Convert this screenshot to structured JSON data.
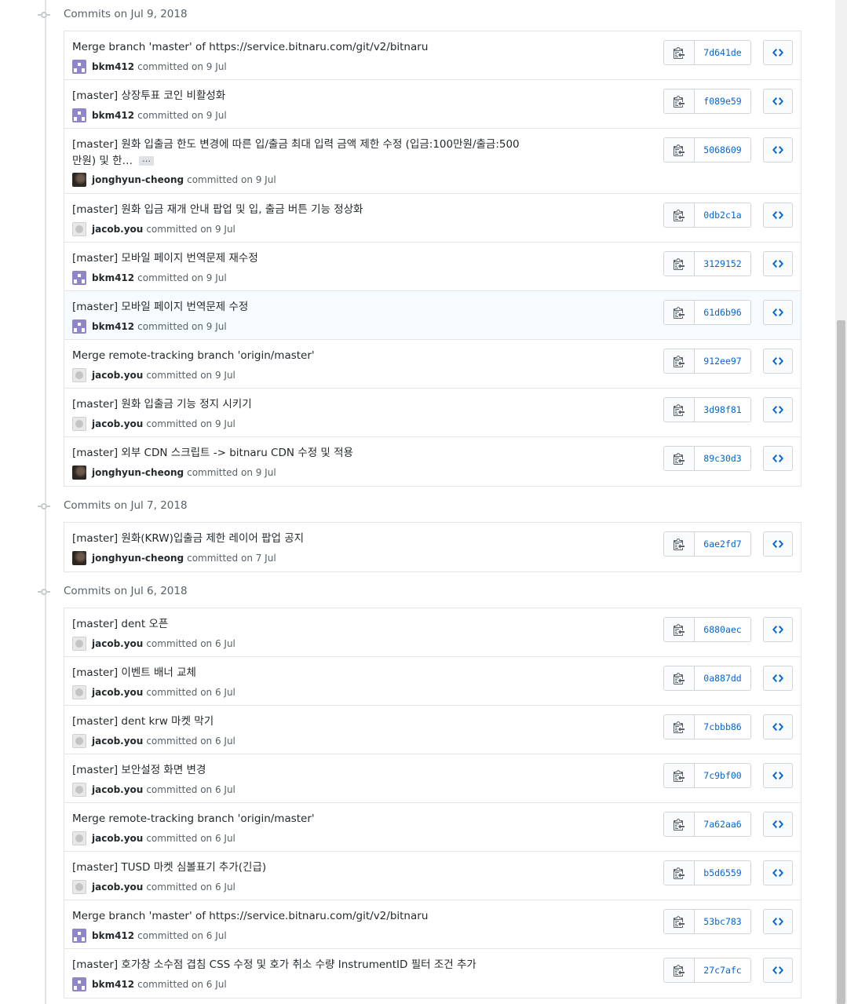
{
  "accent": "#0366d6",
  "groups": [
    {
      "title": "Commits on Jul 9, 2018",
      "commits": [
        {
          "message": "Merge branch 'master' of https://service.bitnaru.com/git/v2/bitnaru",
          "author": "bkm412",
          "committed": "committed on 9 Jul",
          "sha": "7d641de",
          "avatar": "identicon"
        },
        {
          "message": "[master] 상장투표 코인 비활성화",
          "author": "bkm412",
          "committed": "committed on 9 Jul",
          "sha": "f089e59",
          "avatar": "identicon"
        },
        {
          "message": "[master] 원화 입출금 한도 변경에 따른 입/출금 최대 입력 금액 제한 수정 (입금:100만원/출금:500만원) 및 한…",
          "ellipsis": "…",
          "author": "jonghyun-cheong",
          "committed": "committed on 9 Jul",
          "sha": "5068609",
          "avatar": "photo"
        },
        {
          "message": "[master] 원화 입금 재개 안내 팝업 및 입, 출금 버튼 기능 정상화",
          "author": "jacob.you",
          "committed": "committed on 9 Jul",
          "sha": "0db2c1a",
          "avatar": "default"
        },
        {
          "message": "[master] 모바일 페이지 번역문제 재수정",
          "author": "bkm412",
          "committed": "committed on 9 Jul",
          "sha": "3129152",
          "avatar": "identicon"
        },
        {
          "message": "[master] 모바일 페이지 번역문제 수정",
          "author": "bkm412",
          "committed": "committed on 9 Jul",
          "sha": "61d6b96",
          "avatar": "identicon"
        },
        {
          "message": "Merge remote-tracking branch 'origin/master'",
          "author": "jacob.you",
          "committed": "committed on 9 Jul",
          "sha": "912ee97",
          "avatar": "default"
        },
        {
          "message": "[master] 원화 입출금 기능 정지 시키기",
          "author": "jacob.you",
          "committed": "committed on 9 Jul",
          "sha": "3d98f81",
          "avatar": "default"
        },
        {
          "message": "[master] 외부 CDN 스크립트 -> bitnaru CDN 수정 및                          적용",
          "author": "jonghyun-cheong",
          "committed": "committed on 9 Jul",
          "sha": "89c30d3",
          "avatar": "photo"
        }
      ]
    },
    {
      "title": "Commits on Jul 7, 2018",
      "commits": [
        {
          "message": "[master] 원화(KRW)입출금 제한 레이어 팝업 공지",
          "author": "jonghyun-cheong",
          "committed": "committed on 7 Jul",
          "sha": "6ae2fd7",
          "avatar": "photo"
        }
      ]
    },
    {
      "title": "Commits on Jul 6, 2018",
      "commits": [
        {
          "message": "[master] dent 오픈",
          "author": "jacob.you",
          "committed": "committed on 6 Jul",
          "sha": "6880aec",
          "avatar": "default"
        },
        {
          "message": "[master] 이벤트 배너 교체",
          "author": "jacob.you",
          "committed": "committed on 6 Jul",
          "sha": "0a887dd",
          "avatar": "default"
        },
        {
          "message": "[master] dent krw 마켓 막기",
          "author": "jacob.you",
          "committed": "committed on 6 Jul",
          "sha": "7cbbb86",
          "avatar": "default"
        },
        {
          "message": "[master] 보안설정 화면 변경",
          "author": "jacob.you",
          "committed": "committed on 6 Jul",
          "sha": "7c9bf00",
          "avatar": "default"
        },
        {
          "message": "Merge remote-tracking branch 'origin/master'",
          "author": "jacob.you",
          "committed": "committed on 6 Jul",
          "sha": "7a62aa6",
          "avatar": "default"
        },
        {
          "message": "[master] TUSD 마켓 심볼표기 추가(긴급)",
          "author": "jacob.you",
          "committed": "committed on 6 Jul",
          "sha": "b5d6559",
          "avatar": "default"
        },
        {
          "message": "Merge branch 'master' of https://service.bitnaru.com/git/v2/bitnaru",
          "author": "bkm412",
          "committed": "committed on 6 Jul",
          "sha": "53bc783",
          "avatar": "identicon"
        },
        {
          "message": "[master] 호가창 소수점 겹침 CSS 수정 및 호가 취소 수량 InstrumentID 필터 조건 추가",
          "author": "bkm412",
          "committed": "committed on 6 Jul",
          "sha": "27c7afc",
          "avatar": "identicon"
        }
      ]
    }
  ]
}
